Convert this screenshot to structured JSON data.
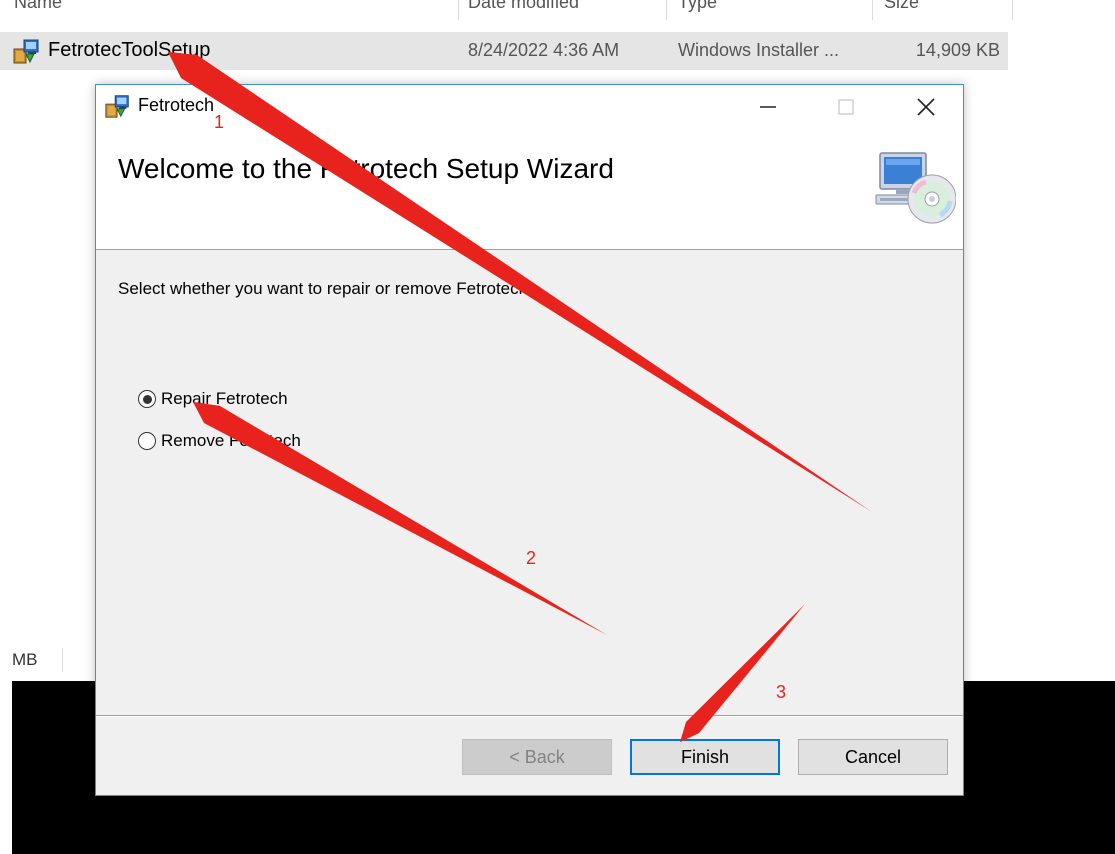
{
  "explorer": {
    "columns": {
      "name": "Name",
      "date": "Date modified",
      "type": "Type",
      "size": "Size"
    },
    "file": {
      "name": "FetrotecToolSetup",
      "date": "8/24/2022 4:36 AM",
      "type": "Windows Installer ...",
      "size": "14,909 KB"
    },
    "partial_size": "MB"
  },
  "dialog": {
    "title": "Fetrotech",
    "banner_title": "Welcome to the Fetrotech Setup Wizard",
    "instruction": "Select whether you want to repair or remove Fetrotech.",
    "options": [
      {
        "label": "Repair Fetrotech",
        "selected": true
      },
      {
        "label": "Remove Fetrotech",
        "selected": false
      }
    ],
    "buttons": {
      "back": "< Back",
      "finish": "Finish",
      "cancel": "Cancel"
    }
  },
  "annotations": {
    "step1": "1",
    "step2": "2",
    "step3": "3",
    "color": "#e8231e"
  },
  "colors": {
    "accent": "#0078d7",
    "dialog_border": "#3f8fd6",
    "dialog_bg": "#f0f0f0",
    "file_row_selected": "#e5e5e5"
  },
  "icons": {
    "file": "installer-package-icon",
    "title": "installer-package-icon",
    "banner": "computer-with-cd-icon"
  }
}
